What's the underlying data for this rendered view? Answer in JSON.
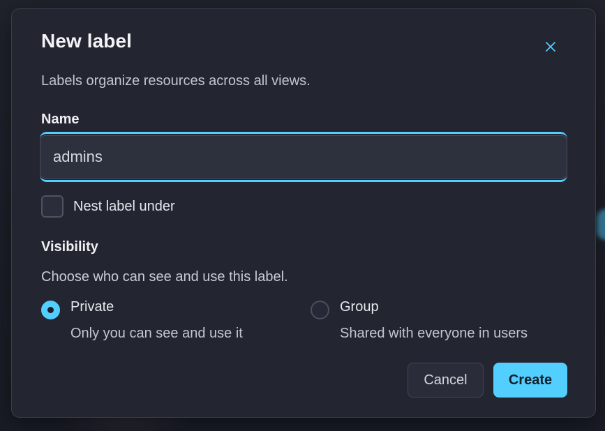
{
  "colors": {
    "accent": "#52ceff",
    "dialog_bg": "#232530",
    "page_bg": "#1b1e27",
    "text_primary": "#f3f4f7",
    "text_secondary": "#c3c6d0"
  },
  "dialog": {
    "title": "New label",
    "subtitle": "Labels organize resources across all views.",
    "close_icon": "close-icon"
  },
  "name_field": {
    "label": "Name",
    "value": "admins",
    "placeholder": ""
  },
  "nest": {
    "label": "Nest label under",
    "checked": false
  },
  "visibility": {
    "title": "Visibility",
    "description": "Choose who can see and use this label.",
    "options": [
      {
        "title": "Private",
        "description": "Only you can see and use it",
        "selected": true
      },
      {
        "title": "Group",
        "description": "Shared with everyone in users",
        "selected": false
      }
    ]
  },
  "actions": {
    "cancel_label": "Cancel",
    "create_label": "Create"
  }
}
